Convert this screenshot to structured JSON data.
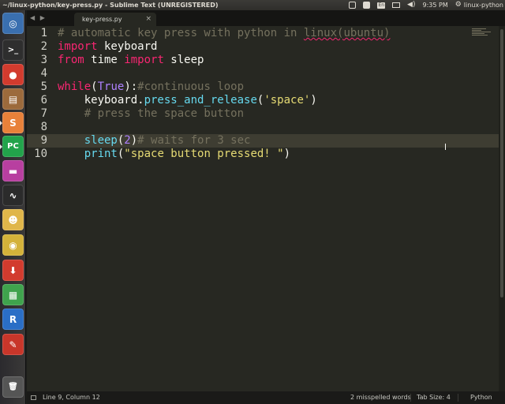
{
  "panel": {
    "title": "~/linux-python/key-press.py - Sublime Text (UNREGISTERED)",
    "lang_badge": "En",
    "time": "9:35 PM",
    "user": "linux-python"
  },
  "launcher": {
    "items": [
      {
        "name": "ubuntu-dash-icon",
        "glyph": "◎",
        "color": "#3a6fb0"
      },
      {
        "name": "terminal-icon",
        "glyph": ">_",
        "color": "#2e2e2e"
      },
      {
        "name": "chrome-icon",
        "glyph": "●",
        "color": "#d23b2e"
      },
      {
        "name": "files-icon",
        "glyph": "▤",
        "color": "#9c6a3c"
      },
      {
        "name": "sublime-text-icon",
        "glyph": "S",
        "color": "#e8813a"
      },
      {
        "name": "pycharm-icon",
        "glyph": "PC",
        "color": "#22a34b"
      },
      {
        "name": "app-icon",
        "glyph": "▬",
        "color": "#b83fa0"
      },
      {
        "name": "system-monitor-icon",
        "glyph": "∿",
        "color": "#2b2b2b"
      },
      {
        "name": "monkey-app-icon",
        "glyph": "☻",
        "color": "#e0b64a"
      },
      {
        "name": "speaker-app-icon",
        "glyph": "◉",
        "color": "#d4b23a"
      },
      {
        "name": "software-updater-icon",
        "glyph": "⬇",
        "color": "#d23b2e"
      },
      {
        "name": "colorful-app-icon",
        "glyph": "▦",
        "color": "#3fa34d"
      },
      {
        "name": "r-language-icon",
        "glyph": "R",
        "color": "#2a6ec6"
      },
      {
        "name": "red-app-icon",
        "glyph": "✎",
        "color": "#c8362a"
      },
      {
        "name": "trash-icon",
        "glyph": "🗑",
        "color": "#555555"
      }
    ]
  },
  "editor": {
    "tab": {
      "label": "key-press.py",
      "close": "×"
    },
    "tab_nav": "◀ ▶",
    "line_numbers": [
      "1",
      "2",
      "3",
      "4",
      "5",
      "6",
      "7",
      "8",
      "9",
      "10"
    ],
    "code": {
      "l1_comment": "# automatic key press with python in ",
      "l1_word_linux": "linux",
      "l1_word_ubuntu": "(ubuntu)",
      "l2_kw": "import",
      "l2_mod": " keyboard",
      "l3_kw1": "from",
      "l3_mod": " time ",
      "l3_kw2": "import",
      "l3_name": " sleep",
      "l5_kw": "while",
      "l5_p1": "(",
      "l5_const": "True",
      "l5_p2": "):",
      "l5_comment": "#continuous loop",
      "l6_obj": "    keyboard.",
      "l6_fn": "press_and_release",
      "l6_p1": "(",
      "l6_str": "'space'",
      "l6_p2": ")",
      "l7_comment": "    # press the space button",
      "l9_fn": "    sleep",
      "l9_p1": "(",
      "l9_num": "2",
      "l9_p2": ")",
      "l9_comment": "# waits for 3 sec",
      "l10_fn": "    print",
      "l10_p1": "(",
      "l10_str": "\"space button pressed! \"",
      "l10_p2": ")"
    }
  },
  "statusbar": {
    "position": "Line 9, Column 12",
    "spelling": "2 misspelled words",
    "tab_size": "Tab Size: 4",
    "syntax": "Python"
  },
  "colors": {
    "editor_bg": "#272822",
    "comment": "#75715e",
    "keyword": "#f92672",
    "builtin": "#66d9ef",
    "number": "#ae81ff",
    "string": "#e6db74"
  }
}
